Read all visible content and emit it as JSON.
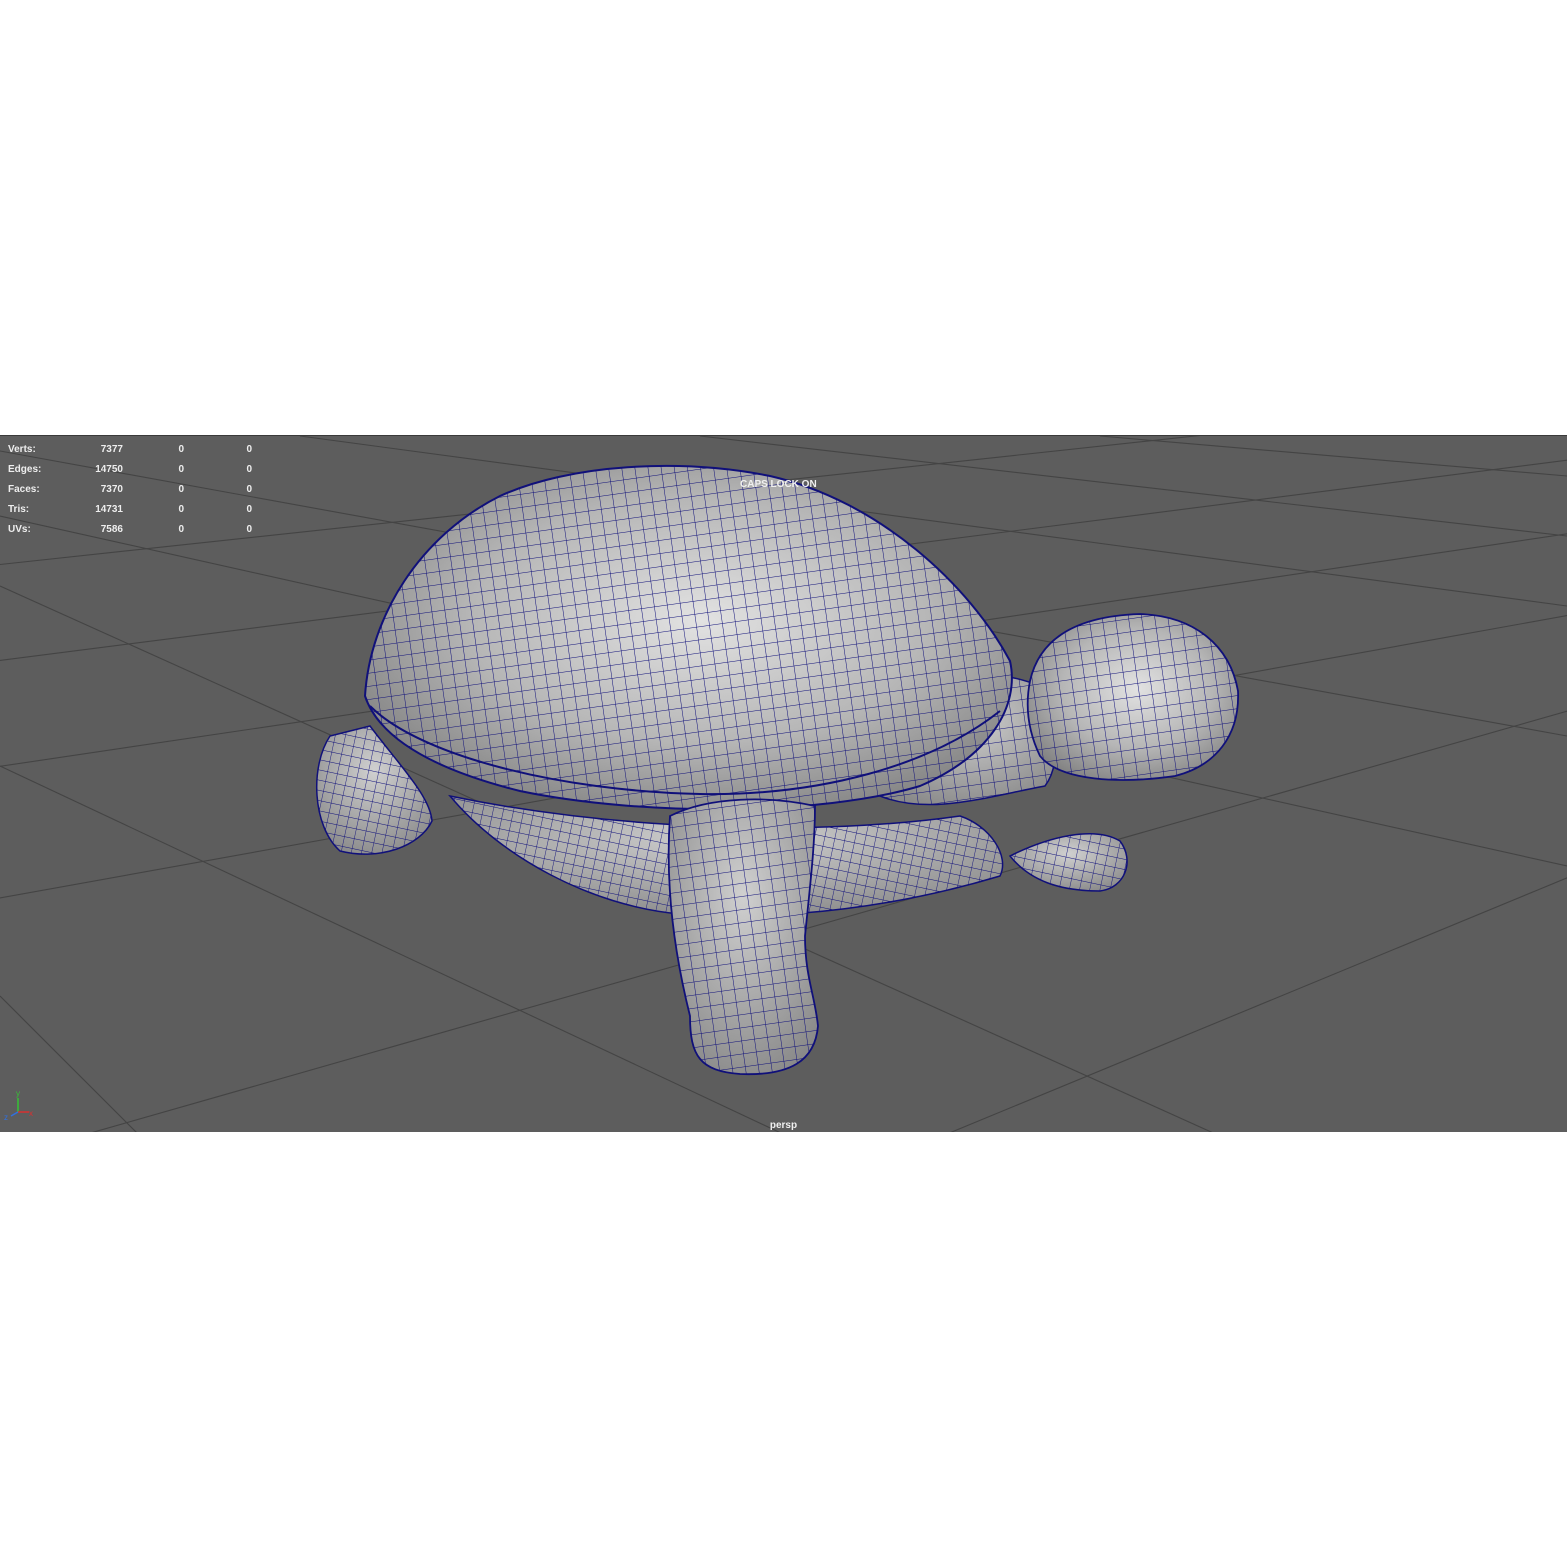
{
  "hud": {
    "rows": [
      {
        "label": "Verts:",
        "c1": "7377",
        "c2": "0",
        "c3": "0"
      },
      {
        "label": "Edges:",
        "c1": "14750",
        "c2": "0",
        "c3": "0"
      },
      {
        "label": "Faces:",
        "c1": "7370",
        "c2": "0",
        "c3": "0"
      },
      {
        "label": "Tris:",
        "c1": "14731",
        "c2": "0",
        "c3": "0"
      },
      {
        "label": "UVs:",
        "c1": "7586",
        "c2": "0",
        "c3": "0"
      }
    ]
  },
  "status": {
    "caps_lock": "CAPS LOCK ON"
  },
  "viewport": {
    "camera": "persp"
  },
  "axis": {
    "y": "y",
    "z": "z",
    "x": "x"
  },
  "colors": {
    "viewport_bg": "#5d5d5d",
    "grid": "#3f3f3f",
    "wire": "#10107a",
    "mesh": "#b4b4b4"
  },
  "icons": {
    "axis": "axis-gizmo-icon"
  }
}
